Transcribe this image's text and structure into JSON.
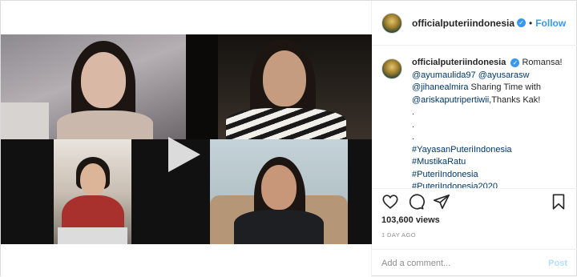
{
  "author": {
    "username": "officialputeriindonesia",
    "follow_label": "Follow",
    "dot": "•"
  },
  "caption": {
    "username": "officialputeriindonesia",
    "first_line": "Romansa!",
    "mention1": "@ayumaulida97",
    "mention2": "@ayusarasw",
    "mention3": "@jihanealmira",
    "text_sharing": "Sharing Time with",
    "mention4": "@ariskaputripertiwii",
    "text_thanks": ",Thanks Kak!",
    "dots": [
      ".",
      ".",
      "."
    ],
    "hashtags": [
      "#YayasanPuteriIndonesia",
      "#MustikaRatu",
      "#PuteriIndonesia",
      "#PuteriIndonesia2020"
    ]
  },
  "stats": {
    "views": "103,600 views",
    "time": "1 DAY AGO"
  },
  "comment": {
    "placeholder": "Add a comment...",
    "post_label": "Post"
  },
  "icons": {
    "like": "heart-icon",
    "comment": "comment-bubble-icon",
    "share": "paper-plane-icon",
    "save": "bookmark-icon",
    "play": "play-icon",
    "verified": "verified-badge-icon"
  },
  "colors": {
    "link": "#3897f0",
    "mention": "#00376b",
    "muted": "#8e8e8e",
    "post_disabled": "#b2dffc"
  }
}
